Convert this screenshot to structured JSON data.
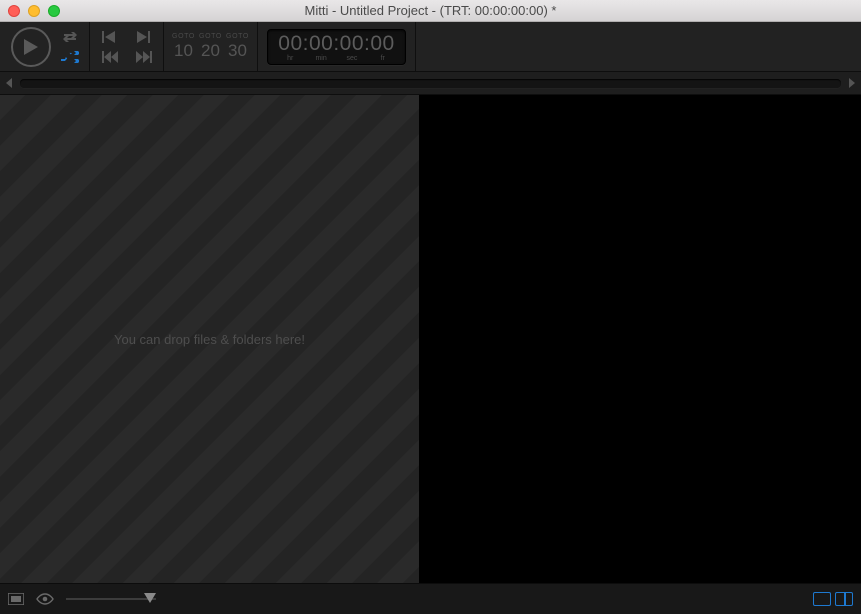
{
  "window": {
    "title": "Mitti - Untitled Project - (TRT: 00:00:00:00) *"
  },
  "toolbar": {
    "goto": [
      {
        "label": "GOTO",
        "num": "10"
      },
      {
        "label": "GOTO",
        "num": "20"
      },
      {
        "label": "GOTO",
        "num": "30"
      }
    ],
    "timecode": {
      "value": "00:00:00:00",
      "units": [
        "hr",
        "min",
        "sec",
        "fr"
      ]
    }
  },
  "cuelist": {
    "drop_hint": "You can drop files & folders here!"
  }
}
